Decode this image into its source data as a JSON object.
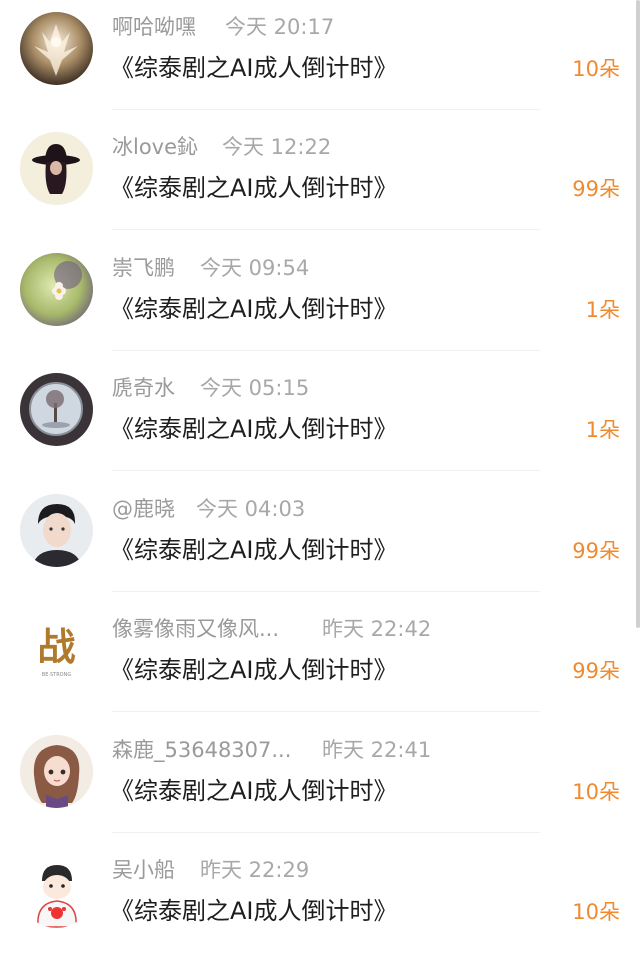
{
  "items": [
    {
      "name": "啊哈呦嘿",
      "time": "今天 20:17",
      "work": "《综泰剧之AI成人倒计时》",
      "count": "10朵",
      "avatar": "ethereal-figure-avatar"
    },
    {
      "name": "冰love鈊",
      "time": "今天 12:22",
      "work": "《综泰剧之AI成人倒计时》",
      "count": "99朵",
      "avatar": "hat-silhouette-avatar"
    },
    {
      "name": "崇飞鹏",
      "time": "今天 09:54",
      "work": "《综泰剧之AI成人倒计时》",
      "count": "1朵",
      "avatar": "flower-avatar"
    },
    {
      "name": "虒奇水",
      "time": "今天 05:15",
      "work": "《综泰剧之AI成人倒计时》",
      "count": "1朵",
      "avatar": "tree-orb-avatar"
    },
    {
      "name": "@鹿晓",
      "time": "今天 04:03",
      "work": "《综泰剧之AI成人倒计时》",
      "count": "99朵",
      "avatar": "boy-portrait-avatar"
    },
    {
      "name": "像雾像雨又像风...",
      "time": "昨天 22:42",
      "work": "《综泰剧之AI成人倒计时》",
      "count": "99朵",
      "avatar": "zhan-calligraphy-avatar"
    },
    {
      "name": "森鹿_53648307...",
      "time": "昨天 22:41",
      "work": "《综泰剧之AI成人倒计时》",
      "count": "10朵",
      "avatar": "anime-girl-avatar"
    },
    {
      "name": "吴小船",
      "time": "昨天 22:29",
      "work": "《综泰剧之AI成人倒计时》",
      "count": "10朵",
      "avatar": "cartoon-avatar"
    }
  ],
  "avatar_glyphs": {
    "zhan": "战",
    "zhan_sub": "BE·STRONG"
  },
  "colors": {
    "name": "#9a9a9a",
    "time": "#a8a8a8",
    "work": "#1e1e1e",
    "count": "#f08a2e"
  }
}
